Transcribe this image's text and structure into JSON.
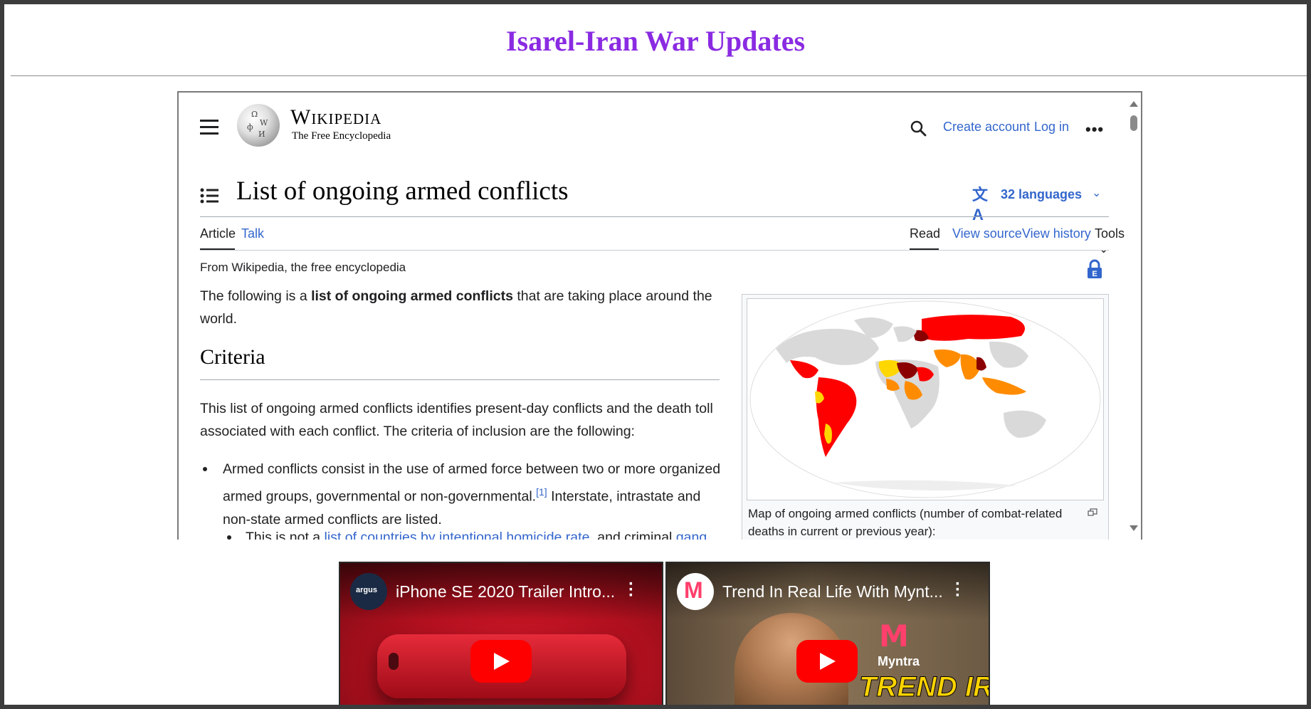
{
  "page": {
    "title": "Isarel-Iran War Updates"
  },
  "wiki": {
    "logo": {
      "wordmark": "Wikipedia",
      "tagline": "The Free Encyclopedia"
    },
    "header": {
      "create_account": "Create account",
      "log_in": "Log in",
      "search_icon": "search-icon",
      "more_icon": "ellipsis-icon"
    },
    "article": {
      "title": "List of ongoing armed conflicts",
      "languages": "32 languages",
      "tabs": {
        "article": "Article",
        "talk": "Talk",
        "read": "Read",
        "view_source": "View source",
        "view_history": "View history",
        "tools": "Tools"
      },
      "from": "From Wikipedia, the free encyclopedia",
      "intro": {
        "pre": "The following is a ",
        "bold": "list of ongoing armed conflicts",
        "post": " that are taking place around the world."
      },
      "criteria_heading": "Criteria",
      "criteria_text": "This list of ongoing armed conflicts identifies present-day conflicts and the death toll associated with each conflict. The criteria of inclusion are the following:",
      "bullet1": {
        "text1": "Armed conflicts consist in the use of armed force between two or more organized armed groups, governmental or non-governmental.",
        "ref": "[1]",
        "text2": " Interstate, intrastate and non-state armed conflicts are listed."
      },
      "sub_bullet": {
        "pre": "This is not a ",
        "link1": "list of countries by intentional homicide rate",
        "mid": ", and criminal ",
        "link2": "gang"
      },
      "map_caption": "Map of ongoing armed conflicts (number of combat-related deaths in current or previous year):"
    }
  },
  "videos": [
    {
      "title": "iPhone SE 2020 Trailer Intro...",
      "channel": "argus",
      "accent": "#d8192b"
    },
    {
      "title": "Trend In Real Life With Mynt...",
      "brand": "Myntra",
      "overlay": "TREND IRL",
      "accent": "#ff3f6c"
    }
  ],
  "colors": {
    "title": "#8a2be2",
    "link": "#3366cc",
    "text": "#202122",
    "conflict_major": "#ff0000",
    "conflict_high": "#8b0000",
    "conflict_mid": "#ff8c00",
    "conflict_low": "#ffd700",
    "land": "#d9d9d9"
  }
}
